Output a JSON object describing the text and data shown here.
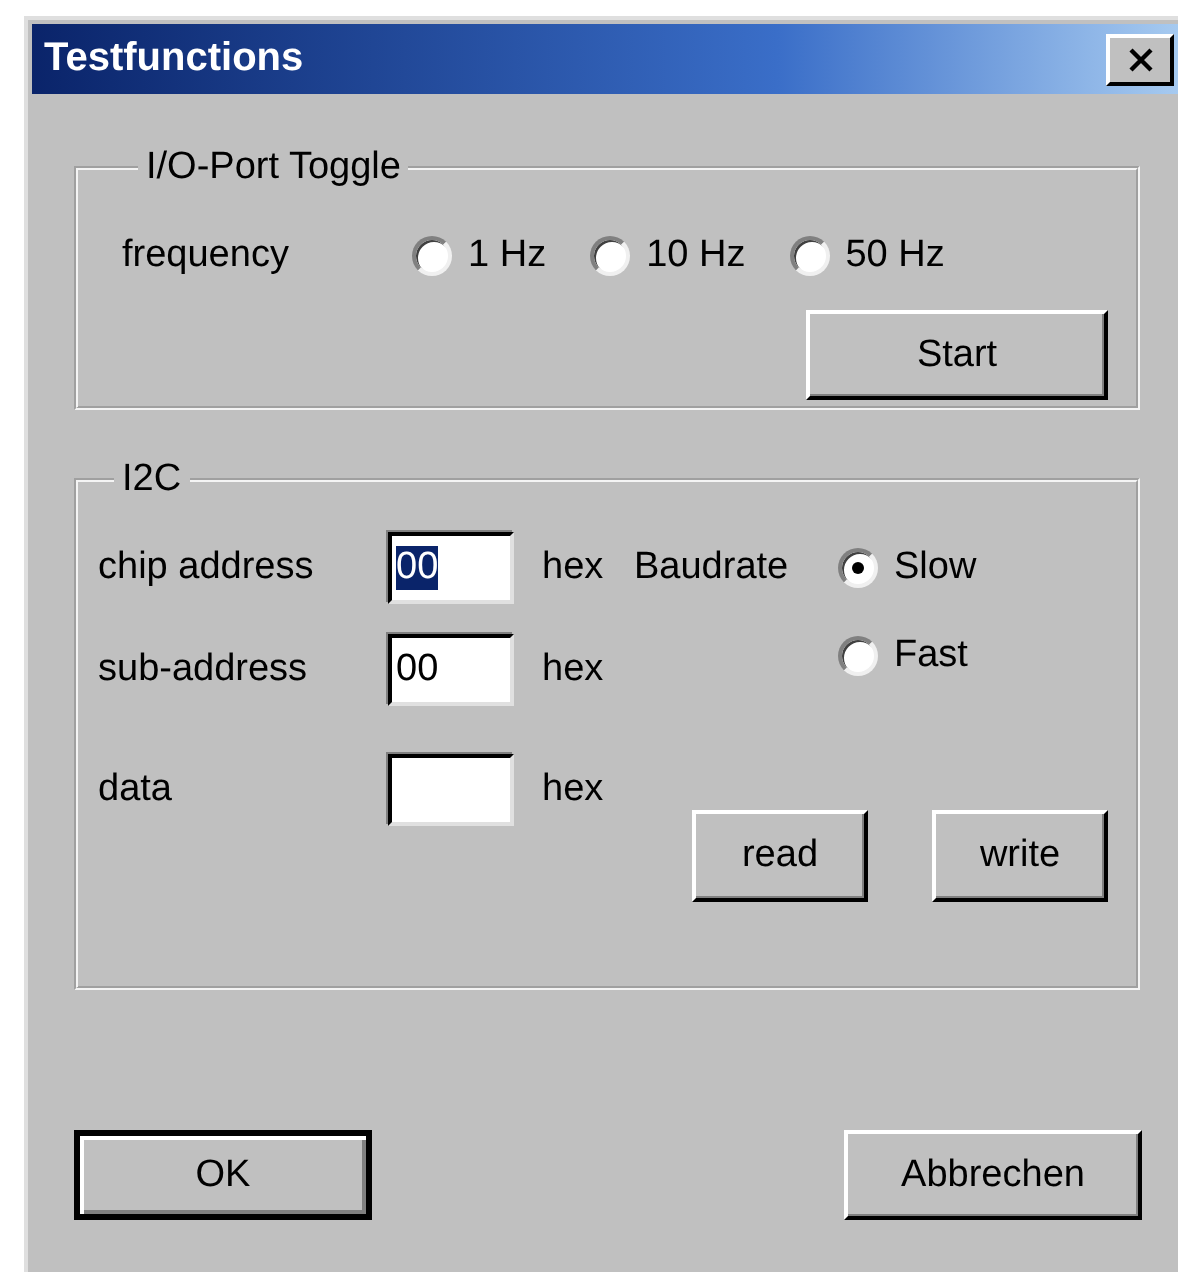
{
  "window": {
    "title": "Testfunctions"
  },
  "io_group": {
    "title": "I/O-Port Toggle",
    "frequency_label": "frequency",
    "frequencies": [
      {
        "label": "1 Hz",
        "selected": false
      },
      {
        "label": "10 Hz",
        "selected": false
      },
      {
        "label": "50 Hz",
        "selected": false
      }
    ],
    "start_button": "Start"
  },
  "i2c_group": {
    "title": "I2C",
    "fields": [
      {
        "label": "chip address",
        "value": "00",
        "text_selected": true,
        "unit": "hex"
      },
      {
        "label": "sub-address",
        "value": "00",
        "text_selected": false,
        "unit": "hex"
      },
      {
        "label": "data",
        "unit": "hex"
      }
    ],
    "baudrate_label": "Baudrate",
    "baudrates": [
      {
        "label": "Slow",
        "selected": true
      },
      {
        "label": "Fast",
        "selected": false
      }
    ],
    "buttons": [
      "read",
      "write"
    ]
  },
  "buttons": [
    {
      "label": "OK",
      "default": true
    },
    {
      "label": "Abbrechen",
      "default": false
    }
  ]
}
